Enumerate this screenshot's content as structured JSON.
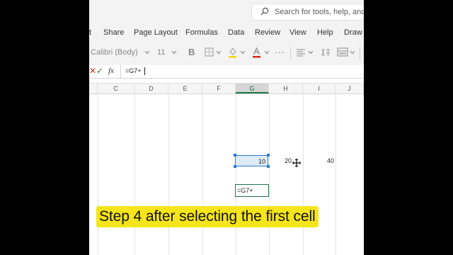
{
  "search": {
    "placeholder": "Search for tools, help, and m"
  },
  "menu": {
    "partial_tab": "t",
    "tabs": [
      "Share",
      "Page Layout",
      "Formulas",
      "Data",
      "Review",
      "View",
      "Help",
      "Draw"
    ]
  },
  "ribbon": {
    "font_name": "Calibri (Body)",
    "font_size": "11",
    "bold": "B",
    "more": "···"
  },
  "formula_bar": {
    "cancel": "✕",
    "confirm": "✓",
    "fx": "fx",
    "value": "=G7+"
  },
  "columns": [
    "C",
    "D",
    "E",
    "F",
    "G",
    "H",
    "I",
    "J"
  ],
  "selected_column": "G",
  "cells": {
    "G7": "10",
    "H7": "20",
    "I7": "40",
    "G9_editing": "=G7+"
  },
  "caption": "Step 4 after selecting the first cell",
  "colors": {
    "accent_green": "#217346",
    "selection_blue": "#2b7bd1",
    "caption_yellow": "#f5e51a"
  },
  "icons": [
    "search-icon",
    "chevron-down-icon",
    "borders-icon",
    "fill-color-icon",
    "font-color-icon",
    "align-icon",
    "text-direction-icon",
    "format-icon",
    "move-cursor-icon"
  ]
}
